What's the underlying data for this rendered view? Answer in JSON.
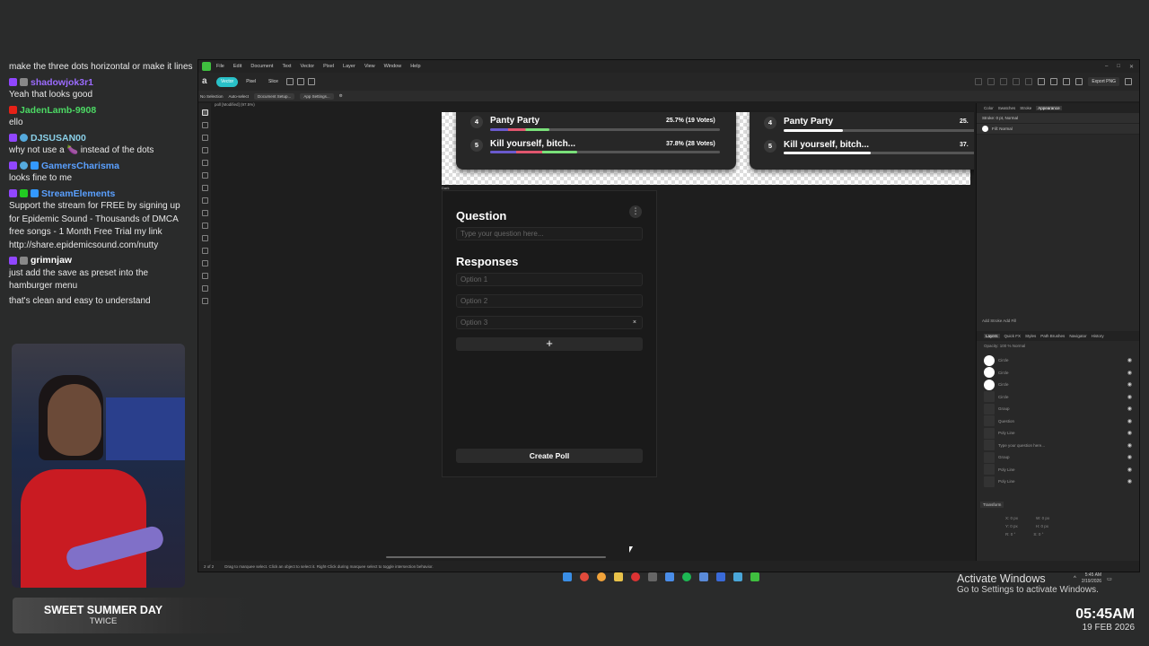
{
  "chat": {
    "messages": [
      {
        "user": "",
        "user_color": "#ffffff",
        "text": "make the three dots horizontal or make it lines",
        "badges": []
      },
      {
        "user": "shadowjok3r1",
        "user_color": "#9b6bff",
        "text": "Yeah that looks good",
        "badges": [
          "twitch",
          "gray"
        ]
      },
      {
        "user": "JadenLamb-9908",
        "user_color": "#4cd964",
        "text": "ello",
        "badges": [
          "youtube"
        ]
      },
      {
        "user": "DJSUSAN00",
        "user_color": "#8ad0e8",
        "text": "why not use a 🍆 instead of the dots",
        "badges": [
          "twitch",
          "shield"
        ]
      },
      {
        "user": "GamersCharisma",
        "user_color": "#5aa0ff",
        "text": "looks fine to me",
        "badges": [
          "twitch",
          "shield",
          "blue"
        ]
      },
      {
        "user": "StreamElements",
        "user_color": "#5aa0ff",
        "text": "Support the stream for FREE by signing up for Epidemic Sound - Thousands of DMCA free songs - 1 Month Free Trial my link http://share.epidemicsound.com/nutty",
        "badges": [
          "twitch",
          "green",
          "blue"
        ]
      },
      {
        "user": "grimnjaw",
        "user_color": "#ffffff",
        "text": "just add the save as preset into the hamburger menu",
        "badges": [
          "twitch",
          "gray"
        ]
      },
      {
        "user": "",
        "user_color": "#ffffff",
        "text": "that's clean and easy to understand",
        "badges": []
      }
    ]
  },
  "song": {
    "title": "SWEET SUMMER DAY",
    "artist": "TWICE"
  },
  "app": {
    "menu": [
      "File",
      "Edit",
      "Document",
      "Text",
      "Vector",
      "Pixel",
      "Layer",
      "View",
      "Window",
      "Help"
    ],
    "personas": [
      "Vector",
      "Pixel",
      "Slice"
    ],
    "export_label": "Export PNG",
    "context": {
      "selection": "No Selection",
      "auto_select": "Auto-select",
      "doc_setup": "Document Setup...",
      "app_settings": "App Settings..."
    },
    "tab": "poll [Modified] (97.5%)",
    "artboard_label": "Dark",
    "status": {
      "pages": "2 of 2",
      "hint": "Drag to marquee select. Click an object to select it. Right-Click during marquee select to toggle intersection behavior."
    }
  },
  "polls": [
    {
      "rows": [
        {
          "num": "4",
          "label": "Panty Party",
          "pct": "25.7% (19 Votes)",
          "fraction": 0.257
        },
        {
          "num": "5",
          "label": "Kill yourself, bitch...",
          "pct": "37.8% (28 Votes)",
          "fraction": 0.378
        }
      ]
    },
    {
      "rows": [
        {
          "num": "4",
          "label": "Panty Party",
          "pct": "25.",
          "fraction": 0.257
        },
        {
          "num": "5",
          "label": "Kill yourself, bitch...",
          "pct": "37.",
          "fraction": 0.378
        }
      ]
    }
  ],
  "creator": {
    "question_heading": "Question",
    "question_placeholder": "Type your question here...",
    "responses_heading": "Responses",
    "options": [
      "Option 1",
      "Option 2",
      "Option 3"
    ],
    "remove_glyph": "×",
    "add_glyph": "+",
    "menu_glyph": "⋮",
    "create_label": "Create Poll"
  },
  "right_panel": {
    "top_tabs": [
      "Color",
      "Swatches",
      "Stroke",
      "Appearance"
    ],
    "stroke_row": "Stroke: 0 pt, Normal",
    "fill_row": "Fill: Normal",
    "footer": "Add Stroke   Add Fill",
    "layer_tabs": [
      "Layers",
      "Quick FX",
      "Styles",
      "Path Brushes",
      "Navigator",
      "History"
    ],
    "opacity_row": "Opacity: 100 %     Normal",
    "layers": [
      "Circle",
      "Circle",
      "Circle",
      "Circle",
      "Group",
      "Question",
      "Poly Line",
      "Type your question here...",
      "Group",
      "Poly Line",
      "Poly Line"
    ],
    "transform_tab": "Transform",
    "transform_fields": [
      "X: 0 px",
      "Y: 0 px",
      "W: 0 px",
      "H: 0 px",
      "R: 0 °",
      "S: 0 °"
    ]
  },
  "windows": {
    "activate_title": "Activate Windows",
    "activate_sub": "Go to Settings to activate Windows.",
    "tray_time": "5:45 AM",
    "tray_date": "2/19/2026",
    "big_time": "05:45AM",
    "big_date": "19 FEB 2026"
  },
  "colors": {
    "accent": "#29c1c8",
    "twitch": "#9146ff",
    "youtube": "#e62117"
  }
}
